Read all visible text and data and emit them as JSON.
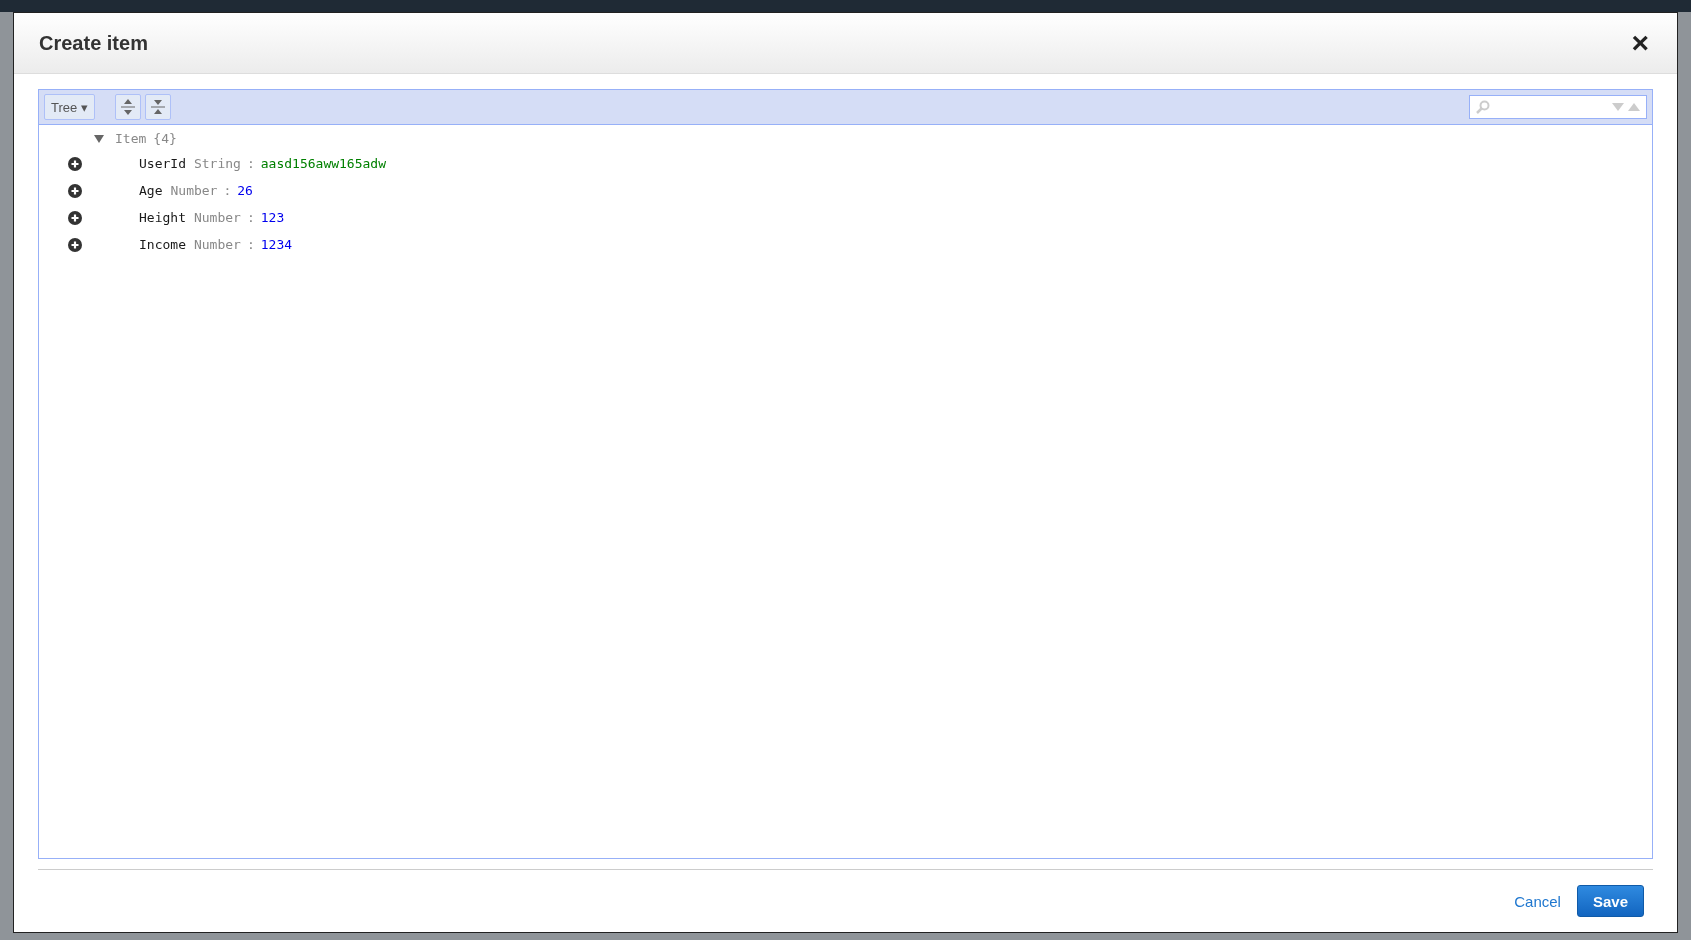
{
  "dialog": {
    "title": "Create item",
    "close": "×"
  },
  "editor": {
    "mode_button": "Tree ▾",
    "root": {
      "name": "Item",
      "count": "{4}",
      "expanded": true
    },
    "fields": [
      {
        "name": "UserId",
        "type": "String",
        "separator": ":",
        "value": "aasd156aww165adw",
        "kind": "string"
      },
      {
        "name": "Age",
        "type": "Number",
        "separator": ":",
        "value": "26",
        "kind": "number"
      },
      {
        "name": "Height",
        "type": "Number",
        "separator": ":",
        "value": "123",
        "kind": "number"
      },
      {
        "name": "Income",
        "type": "Number",
        "separator": ":",
        "value": "1234",
        "kind": "number"
      }
    ]
  },
  "buttons": {
    "cancel": "Cancel",
    "save": "Save"
  }
}
